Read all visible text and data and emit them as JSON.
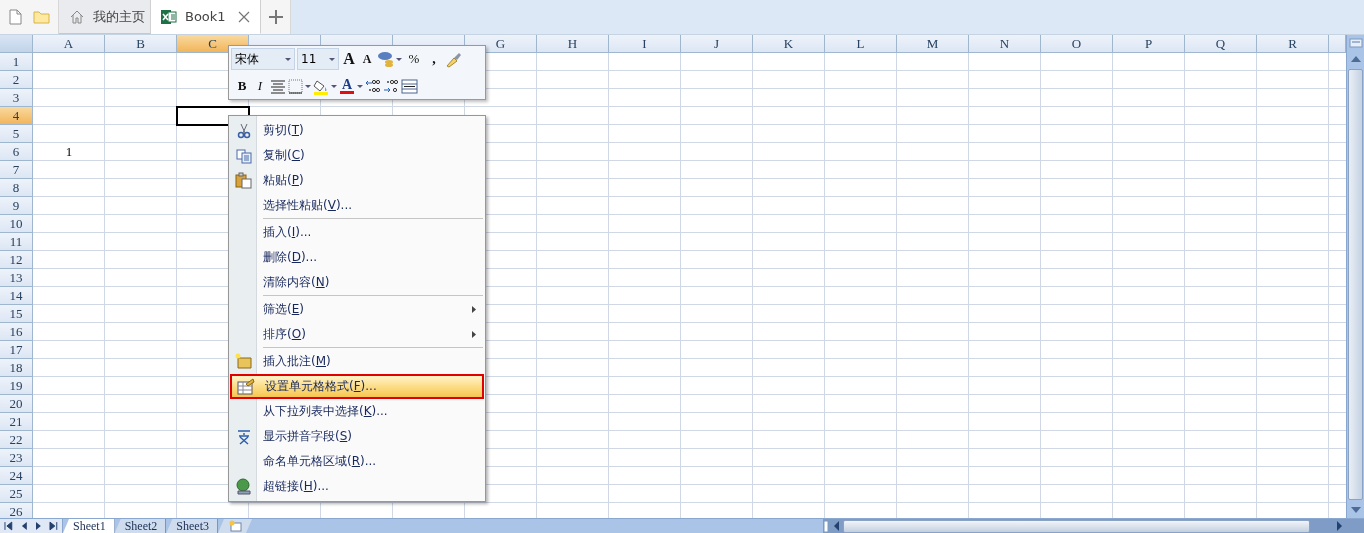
{
  "title_bar": {
    "tabs": [
      {
        "label": "我的主页",
        "selected": false,
        "closable": false
      },
      {
        "label": "Book1",
        "selected": true,
        "closable": true
      }
    ]
  },
  "mini_toolbar": {
    "font": "宋体",
    "size": "11",
    "grow": "A",
    "shrink": "A",
    "percent": "%",
    "comma": ",",
    "bold": "B",
    "italic": "I",
    "font_color": "A"
  },
  "sheet": {
    "columns": [
      {
        "label": "A",
        "selected": false
      },
      {
        "label": "B",
        "selected": false
      },
      {
        "label": "C",
        "selected": true
      },
      {
        "selected": false
      },
      {
        "selected": false
      },
      {
        "selected": false
      },
      {
        "label": "G",
        "selected": false
      },
      {
        "label": "H",
        "selected": false
      },
      {
        "label": "I",
        "selected": false
      },
      {
        "label": "J",
        "selected": false
      },
      {
        "label": "K",
        "selected": false
      },
      {
        "label": "L",
        "selected": false
      },
      {
        "label": "M",
        "selected": false
      },
      {
        "label": "N",
        "selected": false
      },
      {
        "label": "O",
        "selected": false
      },
      {
        "label": "P",
        "selected": false
      },
      {
        "label": "Q",
        "selected": false
      },
      {
        "label": "R",
        "selected": false
      }
    ],
    "rows": [
      {
        "label": "1",
        "selected": false
      },
      {
        "label": "2",
        "selected": false
      },
      {
        "label": "3",
        "selected": false
      },
      {
        "label": "4",
        "selected": true
      },
      {
        "label": "5",
        "selected": false
      },
      {
        "label": "6",
        "selected": false,
        "cells": [
          "1"
        ]
      },
      {
        "label": "7",
        "selected": false
      },
      {
        "label": "8",
        "selected": false
      },
      {
        "label": "9",
        "selected": false
      },
      {
        "label": "10",
        "selected": false
      },
      {
        "label": "11",
        "selected": false
      },
      {
        "label": "12",
        "selected": false
      },
      {
        "label": "13",
        "selected": false
      },
      {
        "label": "14",
        "selected": false
      },
      {
        "label": "15",
        "selected": false
      },
      {
        "label": "16",
        "selected": false
      },
      {
        "label": "17",
        "selected": false
      },
      {
        "label": "18",
        "selected": false
      },
      {
        "label": "19",
        "selected": false
      },
      {
        "label": "20",
        "selected": false
      },
      {
        "label": "21",
        "selected": false
      },
      {
        "label": "22",
        "selected": false
      },
      {
        "label": "23",
        "selected": false
      },
      {
        "label": "24",
        "selected": false
      },
      {
        "label": "25",
        "selected": false
      },
      {
        "label": "26",
        "selected": false
      }
    ]
  },
  "context_menu": [
    {
      "kind": "item",
      "before": "剪切(",
      "accel": "T",
      "after": ")",
      "selected": false
    },
    {
      "kind": "item",
      "before": "复制(",
      "accel": "C",
      "after": ")",
      "selected": false
    },
    {
      "kind": "item",
      "before": "粘贴(",
      "accel": "P",
      "after": ")",
      "selected": false
    },
    {
      "kind": "item",
      "before": "选择性粘贴(",
      "accel": "V",
      "after": ")...",
      "selected": false
    },
    {
      "kind": "separator"
    },
    {
      "kind": "item",
      "before": "插入(",
      "accel": "I",
      "after": ")...",
      "selected": false
    },
    {
      "kind": "item",
      "before": "删除(",
      "accel": "D",
      "after": ")...",
      "selected": false
    },
    {
      "kind": "item",
      "before": "清除内容(",
      "accel": "N",
      "after": ")",
      "selected": false
    },
    {
      "kind": "separator"
    },
    {
      "kind": "item",
      "before": "筛选(",
      "accel": "E",
      "after": ")",
      "selected": false,
      "submenu": true
    },
    {
      "kind": "item",
      "before": "排序(",
      "accel": "O",
      "after": ")",
      "selected": false,
      "submenu": true
    },
    {
      "kind": "separator"
    },
    {
      "kind": "item",
      "before": "插入批注(",
      "accel": "M",
      "after": ")",
      "selected": false
    },
    {
      "kind": "item",
      "before": "设置单元格格式(",
      "accel": "F",
      "after": ")...",
      "selected": true,
      "outlined": true
    },
    {
      "kind": "item",
      "before": "从下拉列表中选择(",
      "accel": "K",
      "after": ")...",
      "selected": false
    },
    {
      "kind": "item",
      "before": "显示拼音字段(",
      "accel": "S",
      "after": ")",
      "selected": false
    },
    {
      "kind": "item",
      "before": "命名单元格区域(",
      "accel": "R",
      "after": ")...",
      "selected": false
    },
    {
      "kind": "item",
      "before": "超链接(",
      "accel": "H",
      "after": ")...",
      "selected": false
    }
  ],
  "sheet_tabs": [
    {
      "label": "Sheet1",
      "selected": true
    },
    {
      "label": "Sheet2",
      "selected": false
    },
    {
      "label": "Sheet3",
      "selected": false
    }
  ]
}
